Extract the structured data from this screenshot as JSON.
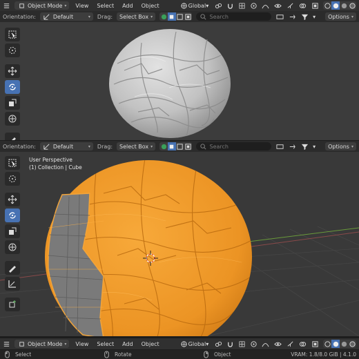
{
  "top": {
    "header": {
      "mode": "Object Mode",
      "menus": [
        "View",
        "Select",
        "Add",
        "Object"
      ],
      "transform_space": "Global"
    },
    "sub": {
      "orientation_label": "Orientation:",
      "orientation_value": "Default",
      "drag_label": "Drag:",
      "drag_value": "Select Box",
      "search_placeholder": "Search",
      "options_label": "Options"
    }
  },
  "bottom": {
    "sub": {
      "orientation_label": "Orientation:",
      "orientation_value": "Default",
      "drag_label": "Drag:",
      "drag_value": "Select Box",
      "search_placeholder": "Search",
      "options_label": "Options"
    },
    "viewport": {
      "perspective": "User Perspective",
      "collection": "(1) Collection | Cube"
    },
    "header": {
      "mode": "Object Mode",
      "menus": [
        "View",
        "Select",
        "Add",
        "Object"
      ],
      "transform_space": "Global"
    }
  },
  "status": {
    "select": "Select",
    "rotate": "Rotate",
    "object": "Object",
    "vram": "VRAM: 1.8/8.0 GiB | 4.1.0"
  },
  "colors": {
    "selection": "#f39a20",
    "active_tool": "#4772b3",
    "sculpt_clay": "#c9c9c9"
  }
}
